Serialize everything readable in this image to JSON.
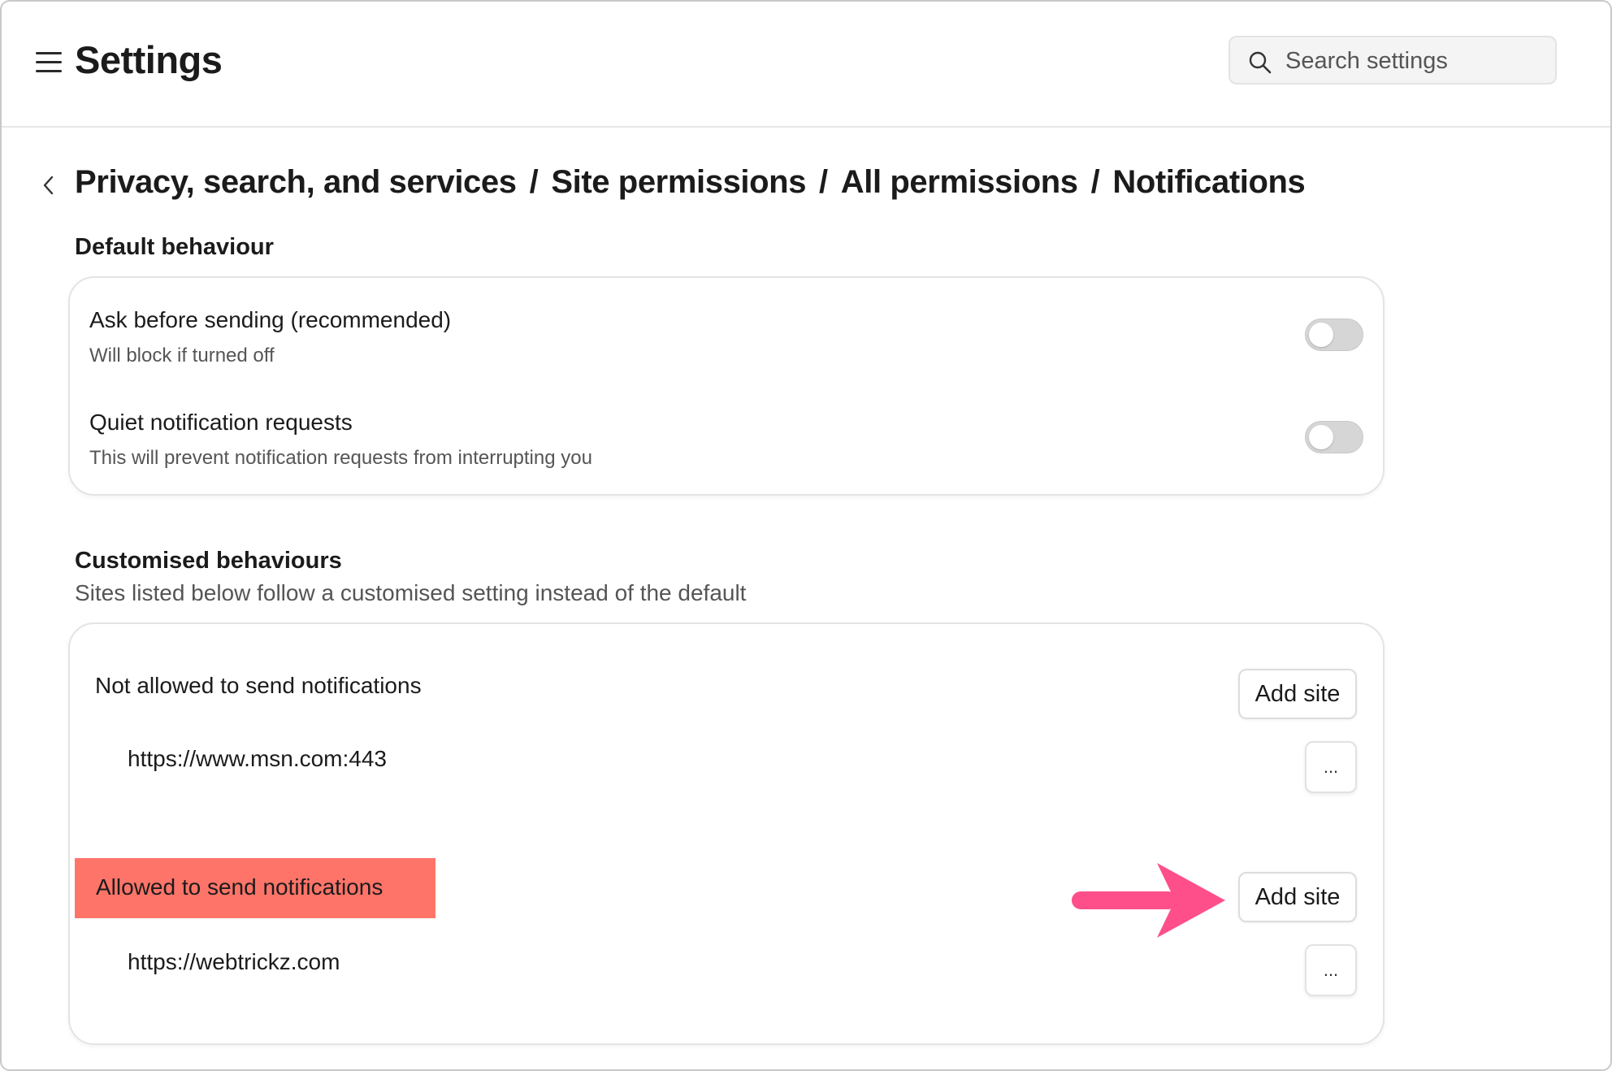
{
  "header": {
    "title": "Settings",
    "search_placeholder": "Search settings"
  },
  "breadcrumb": [
    "Privacy, search, and services",
    "Site permissions",
    "All permissions",
    "Notifications"
  ],
  "default_behaviour": {
    "heading": "Default behaviour",
    "rows": [
      {
        "title": "Ask before sending (recommended)",
        "description": "Will block if turned off",
        "enabled": false
      },
      {
        "title": "Quiet notification requests",
        "description": "This will prevent notification requests from interrupting you",
        "enabled": false
      }
    ]
  },
  "customised": {
    "heading": "Customised behaviours",
    "subtitle": "Sites listed below follow a customised setting instead of the default",
    "blocked": {
      "title": "Not allowed to send notifications",
      "add_label": "Add site",
      "sites": [
        "https://www.msn.com:443"
      ]
    },
    "allowed": {
      "title": "Allowed to send notifications",
      "add_label": "Add site",
      "sites": [
        "https://webtrickz.com"
      ]
    },
    "more_label": "..."
  },
  "colors": {
    "highlight": "#ff7469",
    "arrow": "#ff4f8b",
    "toggle_off": "#d6d6d6"
  },
  "icons": [
    "menu-icon",
    "search-icon",
    "back-chevron-icon",
    "more-options-icon",
    "annotation-arrow-icon"
  ]
}
